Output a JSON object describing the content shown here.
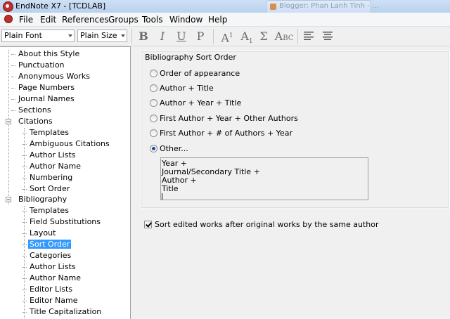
{
  "window": {
    "title": "EndNote X7 - [TCDLAB]",
    "background_tab": "Blogger: Phan Lanh Tinh - ..."
  },
  "menu": {
    "items": [
      "File",
      "Edit",
      "References",
      "Groups",
      "Tools",
      "Window",
      "Help"
    ]
  },
  "toolbar": {
    "font_value": "Plain Font",
    "size_value": "Plain Size",
    "bold": "B",
    "italic": "I",
    "underline": "U",
    "plain": "P",
    "superscript_base": "A",
    "superscript_mark": "1",
    "subscript_base": "A",
    "subscript_mark": "1",
    "symbol": "Σ",
    "smallcaps_a": "A",
    "smallcaps_rest": "BC"
  },
  "tree": {
    "items": [
      "About this Style",
      "Punctuation",
      "Anonymous Works",
      "Page Numbers",
      "Journal Names",
      "Sections",
      "Citations",
      "Templates",
      "Ambiguous Citations",
      "Author Lists",
      "Author Name",
      "Numbering",
      "Sort Order",
      "Bibliography",
      "Templates",
      "Field Substitutions",
      "Layout",
      "Sort Order",
      "Categories",
      "Author Lists",
      "Author Name",
      "Editor Lists",
      "Editor Name",
      "Title Capitalization"
    ],
    "selected": "Sort Order"
  },
  "panel": {
    "group_title": "Bibliography Sort Order",
    "options": [
      "Order of appearance",
      "Author + Title",
      "Author + Year + Title",
      "First Author + Year + Other Authors",
      "First Author + # of Authors + Year",
      "Other..."
    ],
    "selected_option": "Other...",
    "other_lines": [
      "Year +",
      "Journal/Secondary Title +",
      "Author +",
      "Title"
    ],
    "checkbox_label": "Sort edited works after original works by the same author",
    "checkbox_checked": true
  }
}
